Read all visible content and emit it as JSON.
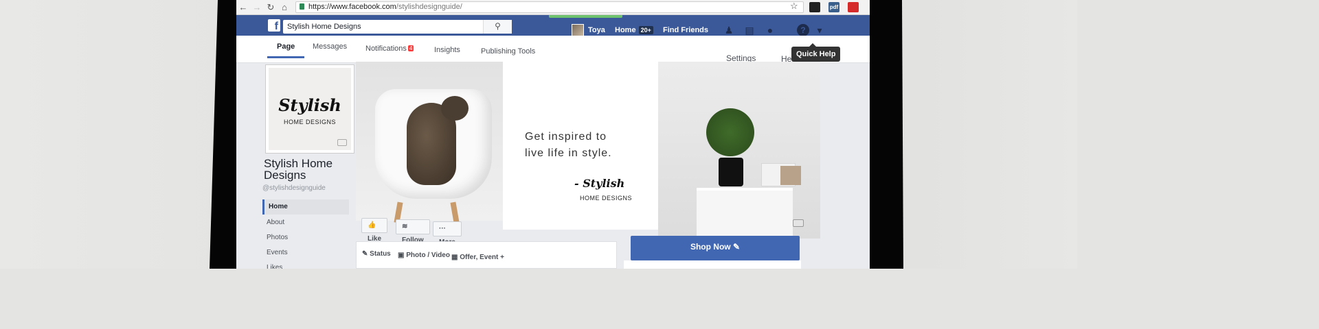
{
  "browser": {
    "url_host": "https://www.facebook.com",
    "url_path": "/stylishdesignguide/",
    "back": "←",
    "forward": "→",
    "reload": "↻",
    "home": "⌂",
    "star": "☆",
    "ext2": "pdf",
    "ext3": ""
  },
  "fb": {
    "search_value": "Stylish Home Designs",
    "user_name": "Toya",
    "home_label": "Home",
    "home_badge": "20+",
    "find_friends": "Find Friends",
    "help_icon": "?",
    "dropdown_icon": "▾"
  },
  "tabs": {
    "page": "Page",
    "messages": "Messages",
    "notifications": "Notifications",
    "notif_count": "4",
    "insights": "Insights",
    "publishing": "Publishing Tools",
    "settings": "Settings",
    "help_partial": "He"
  },
  "tooltip": "Quick Help",
  "profile": {
    "logo_script": "Stylish",
    "logo_sub": "HOME DESIGNS",
    "name": "Stylish Home Designs",
    "handle": "@stylishdesignguide"
  },
  "left_nav": [
    "Home",
    "About",
    "Photos",
    "Events",
    "Likes"
  ],
  "cover": {
    "quote_line1": "Get inspired to",
    "quote_line2": "live life in style.",
    "signature": "- Stylish",
    "signature_sub": "HOME DESIGNS"
  },
  "actions": {
    "like": "Like",
    "follow": "Follow",
    "more": "More",
    "shop_now": "Shop Now"
  },
  "composer": {
    "status": "Status",
    "photo_video": "Photo / Video",
    "offer_event": "Offer, Event +"
  },
  "colors": {
    "fb_blue": "#3b5998",
    "button_blue": "#4267b2",
    "badge_red": "#fa3e3e"
  }
}
